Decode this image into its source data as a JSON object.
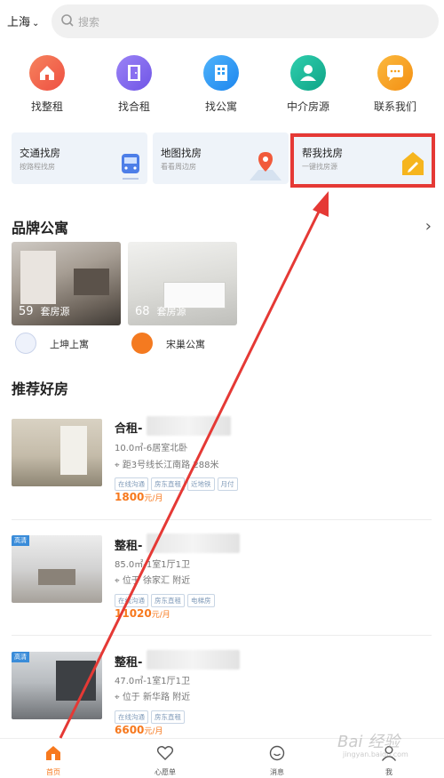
{
  "header": {
    "city": "上海",
    "search_placeholder": "搜索"
  },
  "categories": [
    {
      "label": "找整租",
      "icon": "house-icon",
      "color": "#f26b4e"
    },
    {
      "label": "找合租",
      "icon": "door-icon",
      "color": "#8a6ff0"
    },
    {
      "label": "找公寓",
      "icon": "building-icon",
      "color": "#2f9df4"
    },
    {
      "label": "中介房源",
      "icon": "agent-icon",
      "color": "#19b89a"
    },
    {
      "label": "联系我们",
      "icon": "chat-icon",
      "color": "#f7a21e"
    }
  ],
  "features": [
    {
      "title": "交通找房",
      "subtitle": "按路程找房",
      "icon": "train-icon"
    },
    {
      "title": "地图找房",
      "subtitle": "看看周边房",
      "icon": "map-pin-icon"
    },
    {
      "title": "帮我找房",
      "subtitle": "一键找房源",
      "icon": "edit-icon"
    }
  ],
  "brand_section": {
    "title": "品牌公寓",
    "items": [
      {
        "count": "59",
        "unit": "套房源",
        "name": "上坤上寓"
      },
      {
        "count": "68",
        "unit": "套房源",
        "name": "宋巢公寓"
      }
    ]
  },
  "recommend_section": {
    "title": "推荐好房",
    "listings": [
      {
        "title": "合租-",
        "spec": "10.0㎡-6居室北卧",
        "location": "距3号线长江南路 288米",
        "tags": [
          "在线沟通",
          "房东直租",
          "近地铁",
          "月付"
        ],
        "price": "1800",
        "price_unit": "元/月",
        "badge": ""
      },
      {
        "title": "整租-",
        "spec": "85.0㎡-1室1厅1卫",
        "location": "位于 徐家汇 附近",
        "tags": [
          "在线沟通",
          "房东直租",
          "电梯房"
        ],
        "price": "11020",
        "price_unit": "元/月",
        "badge": "高清"
      },
      {
        "title": "整租-",
        "spec": "47.0㎡-1室1厅1卫",
        "location": "位于 新华路 附近",
        "tags": [
          "在线沟通",
          "房东直租"
        ],
        "price": "6600",
        "price_unit": "元/月",
        "badge": "高清"
      }
    ]
  },
  "bottom_nav": [
    {
      "label": "首页",
      "icon": "home-icon",
      "active": true
    },
    {
      "label": "心愿单",
      "icon": "heart-icon",
      "active": false
    },
    {
      "label": "消息",
      "icon": "message-icon",
      "active": false
    },
    {
      "label": "我",
      "icon": "user-icon",
      "active": false
    }
  ],
  "watermark": {
    "text": "Bai 经验",
    "url": "jingyan.baidu.com"
  },
  "colors": {
    "accent": "#f7791e",
    "highlight": "#e53935"
  }
}
